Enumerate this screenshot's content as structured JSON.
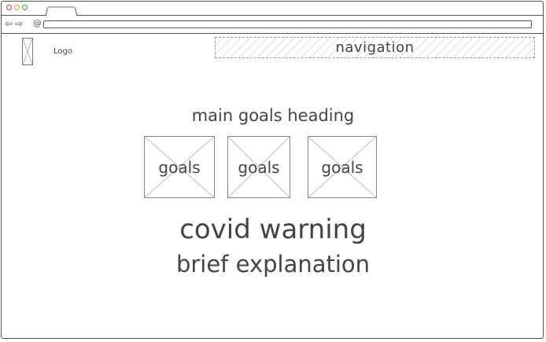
{
  "header": {
    "logo_label": "Logo",
    "navigation_label": "navigation"
  },
  "main": {
    "heading": "main goals heading",
    "goals": [
      {
        "label": "goals"
      },
      {
        "label": "goals"
      },
      {
        "label": "goals"
      }
    ],
    "warning_title": "covid warning",
    "explanation": "brief explanation"
  },
  "colors": {
    "close_dot": "#d04040",
    "minimize_dot": "#d0a020",
    "maximize_dot": "#30a030"
  },
  "icons": [
    "back-arrow-icon",
    "forward-arrow-icon",
    "at-sign-icon"
  ]
}
